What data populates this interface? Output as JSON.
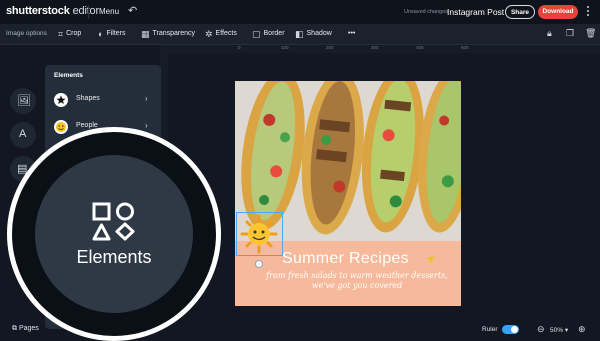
{
  "header": {
    "logo": "shutterstock",
    "logo_suffix": "editor",
    "menu": "Menu",
    "undo_icon": "undo-icon",
    "unsaved": "Unsaved changes",
    "title": "Instagram Post",
    "share": "Share",
    "download": "Download",
    "accent": "#e8423a"
  },
  "options_bar": {
    "label": "Image options",
    "items": [
      {
        "label": "Crop",
        "icon": "crop-icon"
      },
      {
        "label": "Filters",
        "icon": "filters-icon"
      },
      {
        "label": "Transparency",
        "icon": "transparency-icon"
      },
      {
        "label": "Effects",
        "icon": "effects-icon"
      },
      {
        "label": "Border",
        "icon": "border-icon"
      },
      {
        "label": "Shadow",
        "icon": "shadow-icon"
      }
    ],
    "more_icon": "more-icon",
    "right_icons": [
      "lock-icon",
      "duplicate-icon",
      "trash-icon"
    ]
  },
  "ruler_marks": [
    "0",
    "100",
    "200",
    "300",
    "400",
    "500",
    "600",
    "700",
    "800",
    "900",
    "1000"
  ],
  "rail": [
    "image-icon",
    "text-icon",
    "template-icon"
  ],
  "elements_panel": {
    "title": "Elements",
    "rows": [
      {
        "label": "Shapes",
        "icon": "star-icon"
      },
      {
        "label": "People",
        "icon": "emoji-icon"
      }
    ]
  },
  "canvas": {
    "title": "Summer Recipes",
    "subtitle": "from fresh salads to warm weather desserts, we've got you covered",
    "banner_color": "#f7b99b"
  },
  "magnifier": {
    "label": "Elements",
    "icon": "shapes-icon"
  },
  "footer": {
    "pages": "Pages",
    "ruler": "Ruler",
    "zoom": "50%",
    "ruler_on": true
  }
}
